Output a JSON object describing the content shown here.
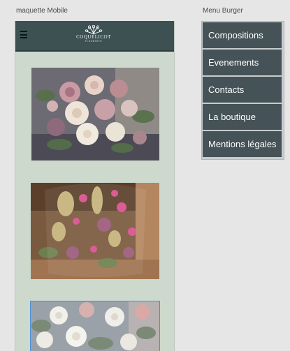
{
  "captions": {
    "mobile": "maquette Mobile",
    "burger": "Menu Burger"
  },
  "header": {
    "brand_name": "COQUELICOT",
    "brand_sub": "FLEURISTE",
    "menu_icon": "hamburger-icon"
  },
  "photos": [
    {
      "name": "rose-bouquet-photo",
      "icon": "photo"
    },
    {
      "name": "dried-flowers-photo",
      "icon": "photo"
    },
    {
      "name": "white-roses-photo",
      "icon": "photo"
    }
  ],
  "menu": {
    "items": [
      {
        "label": "Compositions"
      },
      {
        "label": "Evenements"
      },
      {
        "label": "Contacts"
      },
      {
        "label": "La boutique"
      },
      {
        "label": "Mentions légales"
      }
    ]
  },
  "colors": {
    "header_bg": "#3d5153",
    "mobile_bg": "#ccd9cc",
    "menu_item_bg": "#455257",
    "page_bg": "#e6e6e6"
  }
}
